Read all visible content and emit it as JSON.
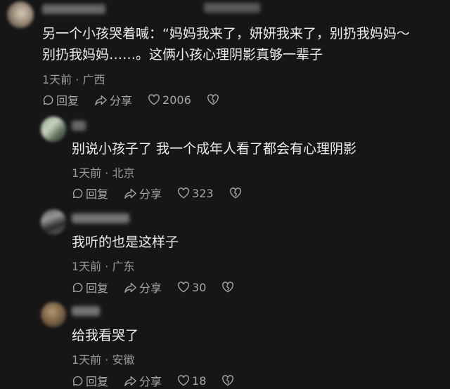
{
  "comments": [
    {
      "text_lines": [
        "另一个小孩哭着喊：“妈妈我来了，妍妍我来了，别扔我妈妈～",
        "别扔我妈妈……。这俩小孩心理阴影真够一辈子"
      ],
      "time": "1天前",
      "location": "广西",
      "reply_label": "回复",
      "share_label": "分享",
      "likes": "2006"
    },
    {
      "text_lines": [
        "别说小孩子了 我一个成年人看了都会有心理阴影"
      ],
      "time": "1天前",
      "location": "北京",
      "reply_label": "回复",
      "share_label": "分享",
      "likes": "323"
    },
    {
      "text_lines": [
        "我听的也是这样子"
      ],
      "time": "1天前",
      "location": "广东",
      "reply_label": "回复",
      "share_label": "分享",
      "likes": "30"
    },
    {
      "text_lines": [
        "给我看哭了"
      ],
      "time": "1天前",
      "location": "安徽",
      "reply_label": "回复",
      "share_label": "分享",
      "likes": "18"
    }
  ],
  "meta_separator": "·",
  "colors": {
    "background": "#161616",
    "text": "#ededed",
    "meta": "#9a9a9a",
    "action": "#a8a8a8"
  },
  "icons": [
    "reply-icon",
    "share-icon",
    "heart-icon",
    "dislike-icon"
  ]
}
